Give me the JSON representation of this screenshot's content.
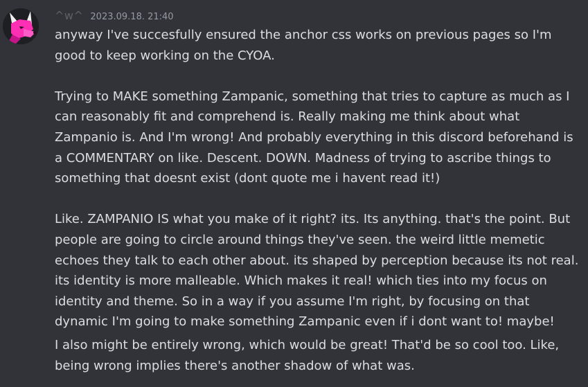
{
  "author": {
    "username": "^w^",
    "avatar_icon": "pink-wolf-avatar-icon",
    "avatar_colors": {
      "background": "#1e1f22",
      "fur": "#ff2fb4",
      "ears": "#f0f0f0"
    }
  },
  "timestamp": "2023.09.18. 21:40",
  "messages": [
    {
      "text": "anyway I've succesfully ensured the anchor css works on previous pages so I'm good to keep working on the CYOA.\n\nTrying to MAKE something Zampanic, something that tries to capture as much as I can reasonably fit and comprehend is. Really making me think about what Zampanio is. And I'm wrong! And probably everything in this discord beforehand is a COMMENTARY on like. Descent. DOWN. Madness of trying to ascribe things to something that doesnt exist (dont quote me i havent read it!)\n\nLike. ZAMPANIO IS what you make of it right? its. Its anything. that's the point. But people are going to circle around things they've seen. the weird little memetic echoes they talk to each other about. its shaped by perception because its not real. its identity is more malleable. Which makes it real! which ties into my focus on identity and theme. So in a way if you assume I'm right, by focusing on that dynamic I'm going to make something Zampanic even if i dont want to! maybe!"
    },
    {
      "text": "I also might be entirely wrong, which would be great! That'd be so cool too. Like, being wrong implies there's another shadow of what was."
    }
  ]
}
